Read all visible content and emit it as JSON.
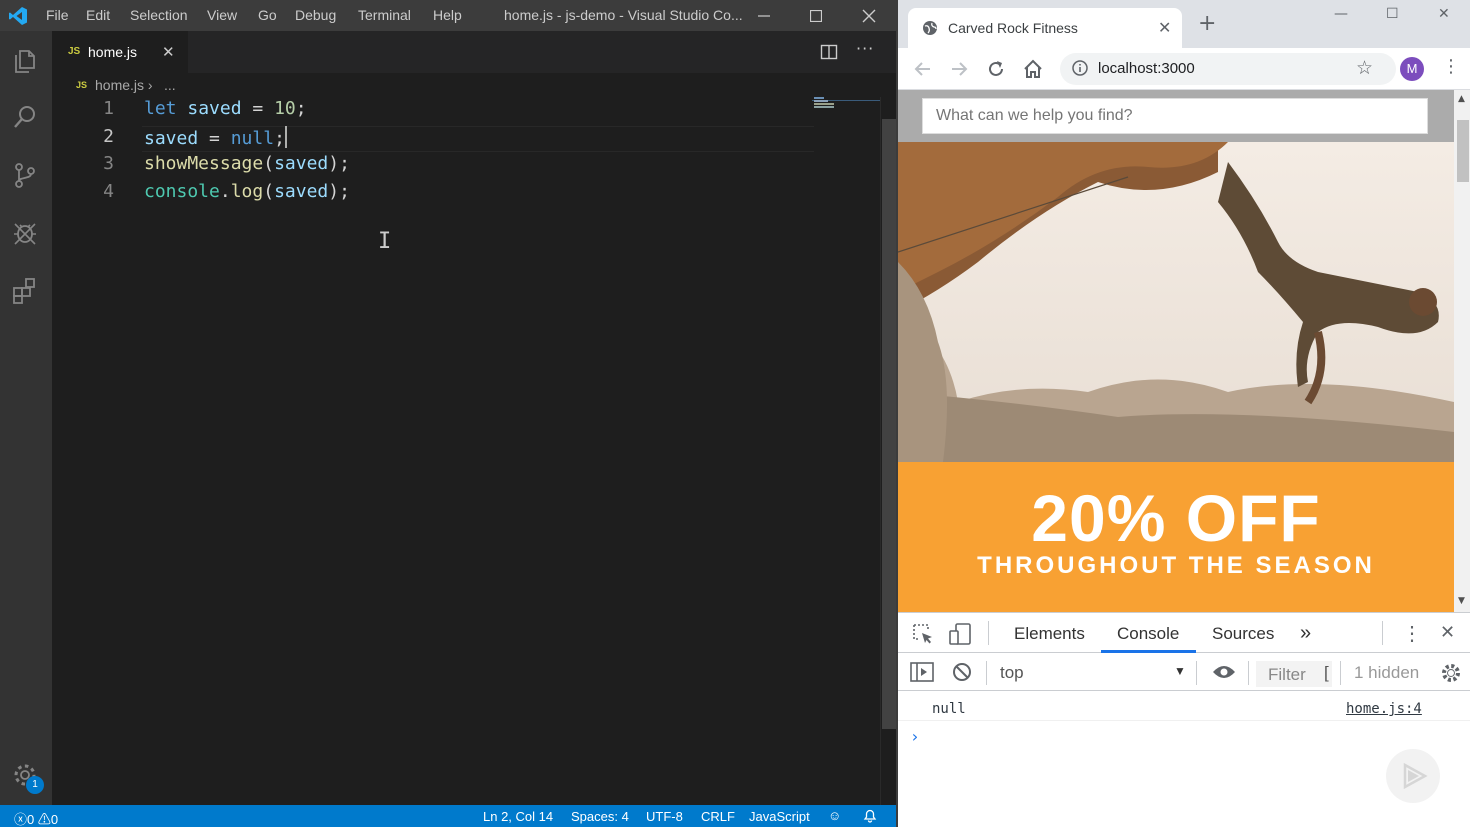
{
  "vscode": {
    "menu": [
      "File",
      "Edit",
      "Selection",
      "View",
      "Go",
      "Debug",
      "Terminal",
      "Help"
    ],
    "window_title": "home.js - js-demo - Visual Studio Co...",
    "tab": {
      "badge": "JS",
      "label": "home.js",
      "close": "✕"
    },
    "breadcrumb": {
      "badge": "JS",
      "file": "home.js",
      "separator": "›",
      "more": "..."
    },
    "code_lines": [
      {
        "number": "1",
        "text": "let saved = 10;"
      },
      {
        "number": "2",
        "text": "saved = null;"
      },
      {
        "number": "3",
        "text": "showMessage(saved);"
      },
      {
        "number": "4",
        "text": "console.log(saved);"
      }
    ],
    "status": {
      "errors": "0",
      "warnings": "0",
      "position": "Ln 2, Col 14",
      "spaces": "Spaces: 4",
      "encoding": "UTF-8",
      "eol": "CRLF",
      "language": "JavaScript"
    },
    "settings_badge": "1",
    "colors": {
      "accent": "#007acc",
      "titlebar": "#3c3c3c",
      "editor_bg": "#1e1e1e"
    }
  },
  "browser": {
    "tab_title": "Carved Rock Fitness",
    "url": "localhost:3000",
    "avatar_initial": "M",
    "page": {
      "search_placeholder": "What can we help you find?",
      "promo_title": "20% OFF",
      "promo_subtitle": "THROUGHOUT THE SEASON"
    },
    "colors": {
      "promo": "#f8a133",
      "avatar": "#7c4dbd"
    }
  },
  "devtools": {
    "tabs": [
      "Elements",
      "Console",
      "Sources"
    ],
    "active_tab": "Console",
    "more_tabs": "»",
    "context": "top",
    "filter_placeholder": "Filter",
    "filter_bracket": "[",
    "hidden_count": "1 hidden",
    "log_value": "null",
    "log_source": "home.js:4",
    "prompt": "›"
  }
}
